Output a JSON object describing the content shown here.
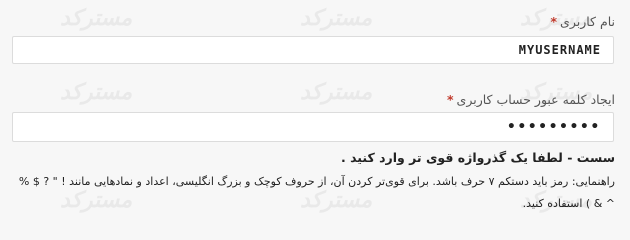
{
  "username": {
    "label": "نام کاربری",
    "required_mark": "*",
    "value": "MYUSERNAME"
  },
  "password": {
    "label": "ایجاد کلمه عبور حساب کاربری",
    "required_mark": "*",
    "value": "•••••••••"
  },
  "strength_text": "سست - لطفا یک گذرواژه قوی تر وارد کنید .",
  "hint_text": "راهنمایی: رمز باید دستکم ۷ حرف باشد. برای قوی‌تر کردن آن، از حروف کوچک و بزرگ انگلیسی، اعداد و نمادهایی مانند ! \" ? $ % ^ & ) استفاده کنید.",
  "watermark": "مسترکد"
}
